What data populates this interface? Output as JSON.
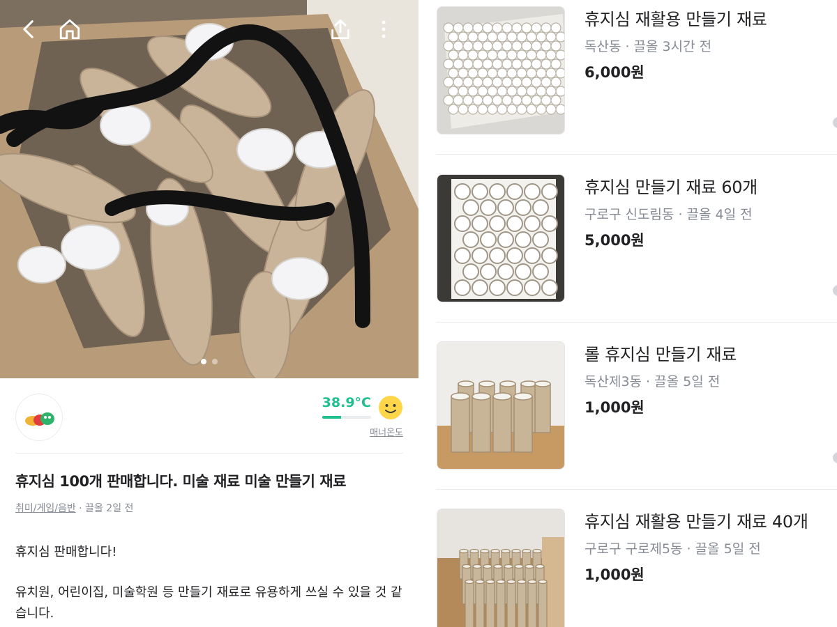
{
  "detail": {
    "image_pager": {
      "count": 2,
      "active_index": 0
    },
    "seller": {
      "manner_temp": "38.9°C",
      "manner_temp_level_percent": 39,
      "manner_label": "매너온도"
    },
    "title": "휴지심 100개 판매합니다. 미술 재료 미술 만들기 재료",
    "category": "취미/게임/음반",
    "meta_sep": " · ",
    "bumped": "끌올 2일 전",
    "description_line1": "휴지심 판매합니다!",
    "description_line2": "유치원, 어린이집, 미술학원 등 만들기 재료로 유용하게 쓰실 수 있을 것 같습니다.",
    "icons": [
      "back-icon",
      "home-icon",
      "share-icon",
      "more-icon",
      "smiley-icon"
    ],
    "colors": {
      "accent": "#1fbf8f",
      "muted": "#868b94",
      "text": "#212124"
    }
  },
  "listings": [
    {
      "name": "휴지심 재활용 만들기 재료",
      "location": "독산동 · 끌올 3시간 전",
      "price": "6,000원"
    },
    {
      "name": "휴지심 만들기 재료 60개",
      "location": "구로구 신도림동 · 끌올 4일 전",
      "price": "5,000원"
    },
    {
      "name": "롤 휴지심 만들기 재료",
      "location": "독산제3동 · 끌올 5일 전",
      "price": "1,000원"
    },
    {
      "name": "휴지심 재활용 만들기 재료 40개",
      "location": "구로구 구로제5동 · 끌올 5일 전",
      "price": "1,000원"
    }
  ]
}
